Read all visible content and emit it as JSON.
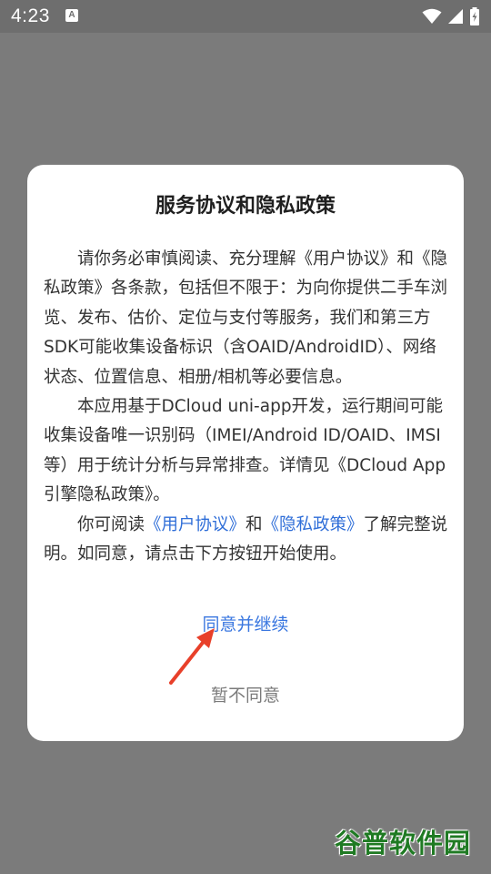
{
  "status_bar": {
    "time": "4:23",
    "notification_glyph": "A",
    "icons": [
      "wifi-icon",
      "signal-icon",
      "battery-icon"
    ]
  },
  "dialog": {
    "title": "服务协议和隐私政策",
    "para1": "请你务必审慎阅读、充分理解《用户协议》和《隐私政策》各条款，包括但不限于：为向你提供二手车浏览、发布、估价、定位与支付等服务，我们和第三方SDK可能收集设备标识（含OAID/AndroidID）、网络状态、位置信息、相册/相机等必要信息。",
    "para2": "本应用基于DCloud uni-app开发，运行期间可能收集设备唯一识别码（IMEI/Android ID/OAID、IMSI等）用于统计分析与异常排查。详情见《DCloud App引擎隐私政策》。",
    "para3_prefix": "你可阅读",
    "link_user_agreement": "《用户协议》",
    "para3_and": "和",
    "link_privacy_policy": "《隐私政策》",
    "para3_suffix": "了解完整说明。如同意，请点击下方按钮开始使用。",
    "agree_button": "同意并继续",
    "decline_button": "暂不同意"
  },
  "watermark": {
    "text": "谷普软件园"
  },
  "colors": {
    "link": "#2f6ed8",
    "agree": "#3a77e0",
    "decline": "#7a7a7a",
    "arrow": "#e8402a",
    "watermark": "#1f7a23"
  }
}
